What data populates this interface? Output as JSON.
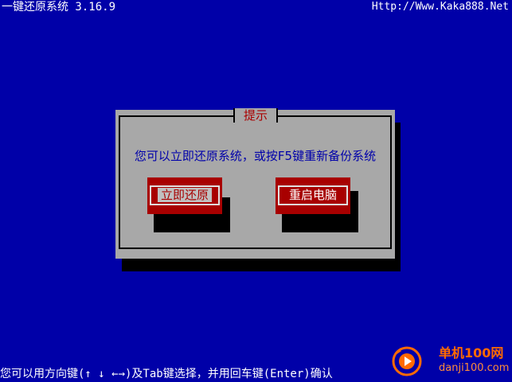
{
  "header": {
    "title": "一键还原系统 3.16.9",
    "url": "Http://Www.Kaka888.Net"
  },
  "dialog": {
    "title": "提示",
    "message": "您可以立即还原系统，或按F5键重新备份系统",
    "buttons": [
      {
        "label": "立即还原",
        "focused": true
      },
      {
        "label": "重启电脑",
        "focused": false
      }
    ]
  },
  "footer": {
    "hint": "您可以用方向键(↑ ↓ ←→)及Tab键选择，并用回车键(Enter)确认"
  },
  "watermark": {
    "name": "单机100网",
    "domain": "danji100.com"
  },
  "colors": {
    "background": "#0000a8",
    "dialog": "#a8a8a8",
    "button": "#a80000",
    "title_text": "#aa0000",
    "message_text": "#0000aa",
    "watermark": "#ff6a00"
  },
  "icons": {
    "watermark_logo": "play-circle-icon"
  }
}
